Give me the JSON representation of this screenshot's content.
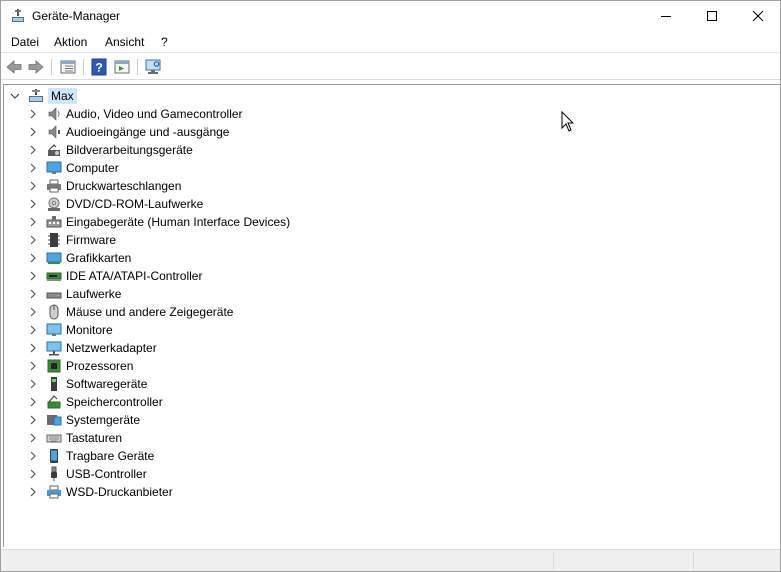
{
  "window": {
    "title": "Geräte-Manager"
  },
  "menu": {
    "items": [
      "Datei",
      "Aktion",
      "Ansicht",
      "?"
    ]
  },
  "toolbar": {
    "buttons": [
      "back-icon",
      "forward-icon",
      "properties-icon",
      "help-icon",
      "update-driver-icon",
      "scan-hardware-icon"
    ]
  },
  "tree": {
    "root": "Max",
    "categories": [
      "Audio, Video und Gamecontroller",
      "Audioeingänge und -ausgänge",
      "Bildverarbeitungsgeräte",
      "Computer",
      "Druckwarteschlangen",
      "DVD/CD-ROM-Laufwerke",
      "Eingabegeräte (Human Interface Devices)",
      "Firmware",
      "Grafikkarten",
      "IDE ATA/ATAPI-Controller",
      "Laufwerke",
      "Mäuse und andere Zeigegeräte",
      "Monitore",
      "Netzwerkadapter",
      "Prozessoren",
      "Softwaregeräte",
      "Speichercontroller",
      "Systemgeräte",
      "Tastaturen",
      "Tragbare Geräte",
      "USB-Controller",
      "WSD-Druckanbieter"
    ]
  }
}
